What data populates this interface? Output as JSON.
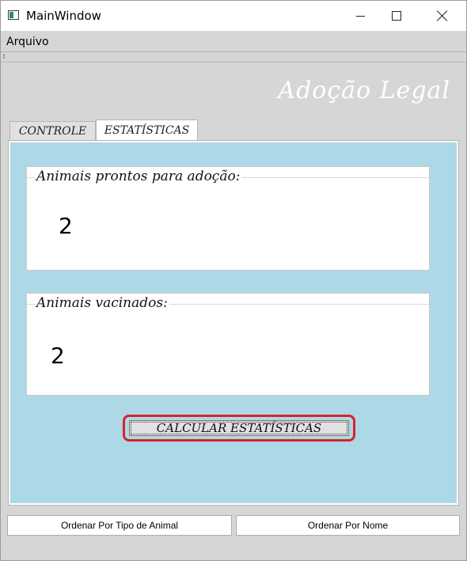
{
  "window": {
    "title": "MainWindow"
  },
  "menu": {
    "items": [
      {
        "label": "Arquivo"
      }
    ]
  },
  "brand": {
    "text": "Adoção Legal"
  },
  "tabs": [
    {
      "label": "CONTROLE",
      "active": false
    },
    {
      "label": "ESTATÍSTICAS",
      "active": true
    }
  ],
  "stats": {
    "ready_for_adoption": {
      "label": "Animais prontos para adoção:",
      "value": "2"
    },
    "vaccinated": {
      "label": "Animais vacinados:",
      "value": "2"
    },
    "calculate_button": "CALCULAR ESTATÍSTICAS"
  },
  "footer": {
    "sort_by_type": "Ordenar Por Tipo de Animal",
    "sort_by_name": "Ordenar Por Nome"
  },
  "colors": {
    "panel_background": "#add8e6",
    "highlight": "#d9222a",
    "window_background": "#d6d6d6"
  },
  "icons": {
    "app": "app-window-icon",
    "minimize": "minimize-icon",
    "maximize": "maximize-icon",
    "close": "close-icon"
  }
}
